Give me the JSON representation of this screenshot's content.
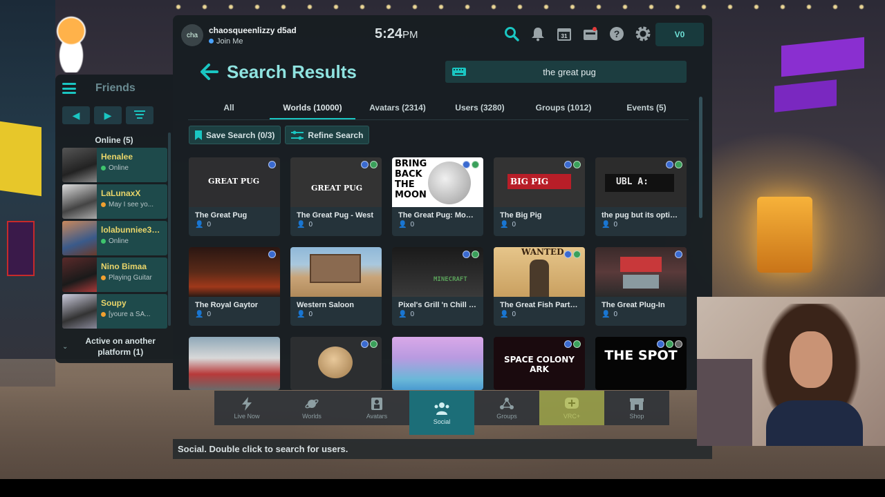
{
  "user": {
    "short": "cha",
    "name": "chaosqueenlizzy d5ad",
    "status": "Join Me",
    "status_color": "#4aa3ff"
  },
  "clock": {
    "time": "5:24",
    "ampm": "PM"
  },
  "currency": "V0",
  "top_icons": [
    "search-icon",
    "bell-icon",
    "calendar-icon",
    "camera-icon",
    "help-icon",
    "gear-icon"
  ],
  "page": {
    "title": "Search Results",
    "query": "the great pug"
  },
  "tabs": [
    {
      "label": "All",
      "active": false
    },
    {
      "label": "Worlds (10000)",
      "active": true
    },
    {
      "label": "Avatars (2314)",
      "active": false
    },
    {
      "label": "Users (3280)",
      "active": false
    },
    {
      "label": "Groups (1012)",
      "active": false
    },
    {
      "label": "Events (5)",
      "active": false
    }
  ],
  "actions": {
    "save": "Save Search (0/3)",
    "refine": "Refine Search"
  },
  "worlds": [
    {
      "name": "The Great Pug",
      "count": "0",
      "thumb_text": "GREAT PUG"
    },
    {
      "name": "The Great Pug - West",
      "count": "0",
      "thumb_text": "GREAT PUG"
    },
    {
      "name": "The Great Pug: Moon ...",
      "count": "0",
      "thumb_text": "BRING BACK THE MOON"
    },
    {
      "name": "The Big Pig",
      "count": "0",
      "thumb_text": "BIG PIG"
    },
    {
      "name": "the pug but its optimi...",
      "count": "0",
      "thumb_text": "UBL A:"
    },
    {
      "name": "The Royal Gaytor",
      "count": "0",
      "thumb_text": ""
    },
    {
      "name": "Western Saloon",
      "count": "0",
      "thumb_text": ""
    },
    {
      "name": "Pixel's Grill 'n Chill - T...",
      "count": "0",
      "thumb_text": "MINECRAFT"
    },
    {
      "name": "The Great Fish Party ...",
      "count": "0",
      "thumb_text": "WANTED"
    },
    {
      "name": "The Great Plug-In",
      "count": "0",
      "thumb_text": ""
    },
    {
      "name": "",
      "count": "",
      "thumb_text": ""
    },
    {
      "name": "",
      "count": "",
      "thumb_text": ""
    },
    {
      "name": "",
      "count": "",
      "thumb_text": ""
    },
    {
      "name": "",
      "count": "",
      "thumb_text": "SPACE COLONY ARK"
    },
    {
      "name": "",
      "count": "",
      "thumb_text": "THE SPOT"
    }
  ],
  "friends": {
    "title": "Friends",
    "online_header": "Online (5)",
    "list": [
      {
        "name": "Henalee",
        "status": "Online",
        "dot": "#3ec46d"
      },
      {
        "name": "LaLunaxX",
        "status": "May I see yo...",
        "dot": "#f0a030"
      },
      {
        "name": "lolabunniee37f8",
        "status": "Online",
        "dot": "#3ec46d"
      },
      {
        "name": "Nino Bimaa",
        "status": "Playing Guitar",
        "dot": "#f0a030"
      },
      {
        "name": "Soupy",
        "status": "[youre a SA...",
        "dot": "#f0a030"
      }
    ],
    "active_other": "Active on another platform (1)"
  },
  "dock": [
    {
      "label": "Live Now",
      "icon": "bolt-icon"
    },
    {
      "label": "Worlds",
      "icon": "planet-icon"
    },
    {
      "label": "Avatars",
      "icon": "avatar-icon"
    },
    {
      "label": "Social",
      "icon": "social-icon"
    },
    {
      "label": "Groups",
      "icon": "groups-icon"
    },
    {
      "label": "VRC+",
      "icon": "plus-icon"
    },
    {
      "label": "Shop",
      "icon": "shop-icon"
    }
  ],
  "tooltip": "Social. Double click to search for users.",
  "colors": {
    "accent": "#1ac6c2",
    "title": "#8fe3e0",
    "friend_name": "#e9d56a"
  }
}
